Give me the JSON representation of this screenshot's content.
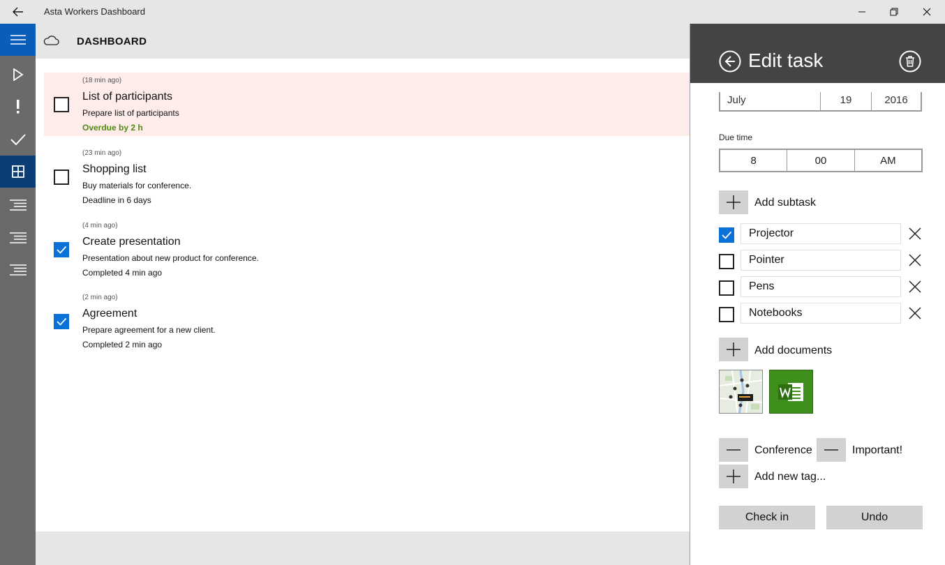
{
  "window": {
    "title": "Asta Workers Dashboard"
  },
  "header": {
    "title": "DASHBOARD"
  },
  "rail": {
    "items": [
      {
        "icon": "hamburger-icon"
      },
      {
        "icon": "play-icon"
      },
      {
        "icon": "exclamation-icon"
      },
      {
        "icon": "check-icon"
      },
      {
        "icon": "grid-icon",
        "active": true
      },
      {
        "icon": "list-icon"
      },
      {
        "icon": "list-icon"
      },
      {
        "icon": "list-icon"
      }
    ]
  },
  "tasks": [
    {
      "ago": "(18 min ago)",
      "title": "List of participants",
      "description": "Prepare list of participants",
      "status": "Overdue by 2 h",
      "checked": false,
      "overdue": true
    },
    {
      "ago": "(23 min ago)",
      "title": "Shopping list",
      "description": "Buy materials for conference.",
      "status": "Deadline in 6 days",
      "checked": false,
      "overdue": false
    },
    {
      "ago": "(4 min ago)",
      "title": "Create presentation",
      "description": "Presentation about new product for conference.",
      "status": "Completed 4 min ago",
      "checked": true,
      "overdue": false
    },
    {
      "ago": "(2 min ago)",
      "title": "Agreement",
      "description": "Prepare agreement for a new client.",
      "status": "Completed 2 min ago",
      "checked": true,
      "overdue": false
    }
  ],
  "edit_panel": {
    "title": "Edit task",
    "due_date": {
      "month": "July",
      "day": "19",
      "year": "2016"
    },
    "due_time_label": "Due time",
    "due_time": {
      "hour": "8",
      "minute": "00",
      "ampm": "AM"
    },
    "add_subtask_label": "Add subtask",
    "subtasks": [
      {
        "text": "Projector",
        "checked": true
      },
      {
        "text": "Pointer",
        "checked": false
      },
      {
        "text": "Pens",
        "checked": false
      },
      {
        "text": "Notebooks",
        "checked": false
      }
    ],
    "add_documents_label": "Add documents",
    "documents": [
      {
        "kind": "map-image"
      },
      {
        "kind": "word-document"
      }
    ],
    "tags": [
      "Conference",
      "Important!"
    ],
    "add_tag_label": "Add new tag...",
    "check_in_label": "Check in",
    "undo_label": "Undo"
  },
  "colors": {
    "accent": "#0a72d6",
    "rail_bg": "#6a6a6a",
    "rail_hamburger": "#0a5db8",
    "rail_active": "#0b3e74",
    "overdue_bg": "#fdecea",
    "overdue_text": "#4f8a10",
    "panel_header": "#444444",
    "word_green": "#3f8f1d"
  }
}
